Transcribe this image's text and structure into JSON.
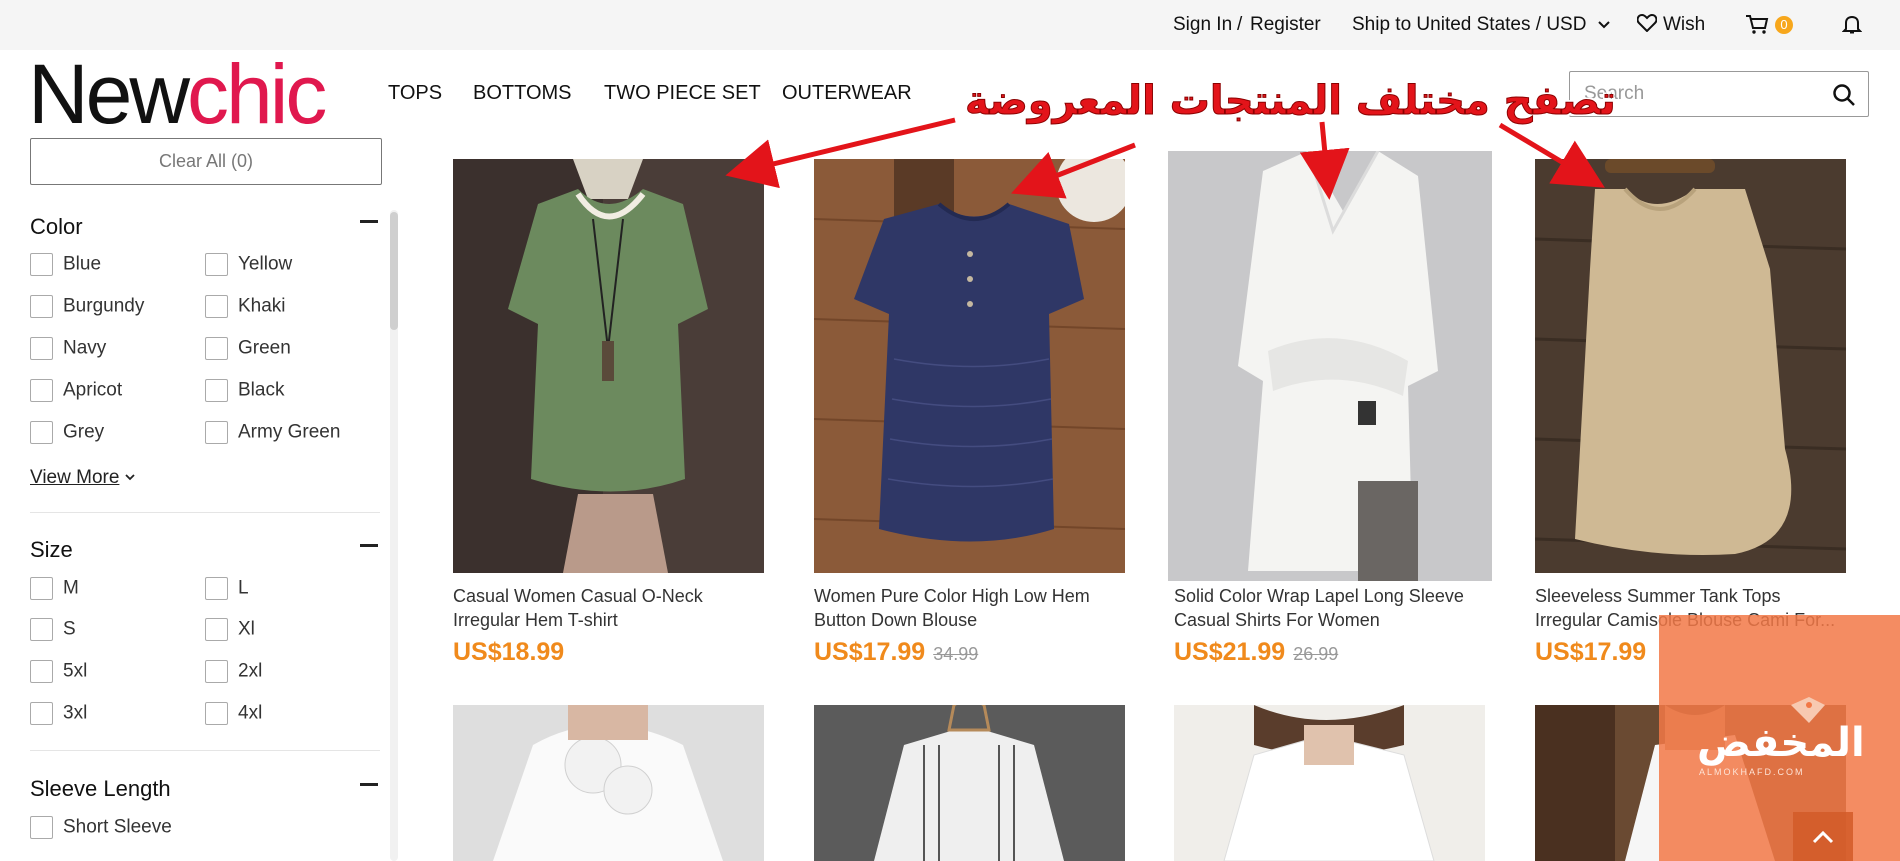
{
  "topbar": {
    "sign_in": "Sign In",
    "separator": "/",
    "register": "Register",
    "ship_to": "Ship to United States / USD",
    "wish": "Wish",
    "cart_count": "0",
    "accent": "#f7a71c"
  },
  "header": {
    "logo_part1": "New",
    "logo_part2": "chic",
    "logo_color": "#e0184e",
    "nav": [
      "TOPS",
      "BOTTOMS",
      "TWO PIECE SET",
      "OUTERWEAR"
    ],
    "search_placeholder": "Search"
  },
  "sidebar": {
    "clear_all": "Clear All (0)",
    "color": {
      "title": "Color",
      "options": [
        "Blue",
        "Yellow",
        "Burgundy",
        "Khaki",
        "Navy",
        "Green",
        "Apricot",
        "Black",
        "Grey",
        "Army Green"
      ],
      "view_more": "View More"
    },
    "size": {
      "title": "Size",
      "options": [
        "M",
        "L",
        "S",
        "Xl",
        "5xl",
        "2xl",
        "3xl",
        "4xl"
      ]
    },
    "sleeve": {
      "title": "Sleeve Length",
      "options": [
        "Short Sleeve"
      ]
    }
  },
  "products": [
    {
      "title": "Casual Women Casual O-Neck Irregular Hem T-shirt",
      "price": "US$18.99",
      "old_price": ""
    },
    {
      "title": "Women Pure Color High Low Hem Button Down Blouse",
      "price": "US$17.99",
      "old_price": "34.99"
    },
    {
      "title": "Solid Color Wrap Lapel Long Sleeve Casual Shirts For Women",
      "price": "US$21.99",
      "old_price": "26.99"
    },
    {
      "title": "Sleeveless Summer Tank Tops Irregular Camisole Blouse Cami For...",
      "price": "US$17.99",
      "old_price": ""
    }
  ],
  "annotation": "تصفح مختلف المنتجات المعروضة",
  "watermark": {
    "logo": "المخفض",
    "sub": "ALMOKHAFD.COM"
  },
  "price_color": "#f08a1c"
}
